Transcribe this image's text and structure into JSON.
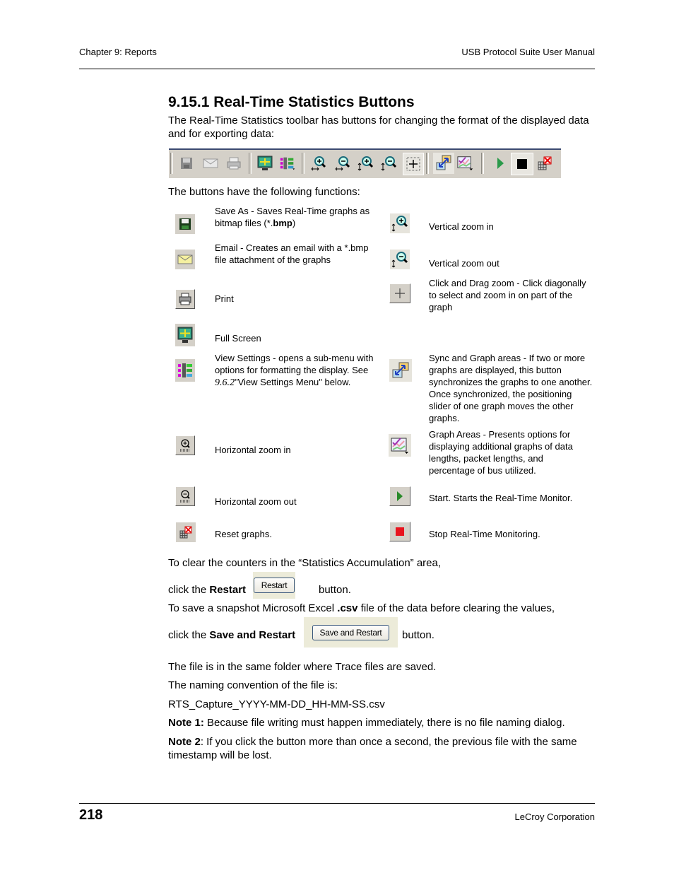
{
  "header": {
    "left": "Chapter 9: Reports",
    "right": "USB Protocol Suite User Manual"
  },
  "section": {
    "title": "9.15.1 Real-Time Statistics Buttons",
    "intro": "The Real-Time Statistics toolbar has buttons for changing the format of the displayed data and for exporting data:",
    "functions_intro": "The buttons have the following functions:"
  },
  "toolbar": {
    "buttons": [
      {
        "icon": "save-icon"
      },
      {
        "icon": "email-icon"
      },
      {
        "icon": "print-icon"
      },
      {
        "icon": "full-screen-icon"
      },
      {
        "icon": "view-settings-icon"
      },
      {
        "icon": "horizontal-zoom-in-icon"
      },
      {
        "icon": "horizontal-zoom-out-icon"
      },
      {
        "icon": "vertical-zoom-in-icon"
      },
      {
        "icon": "vertical-zoom-out-icon"
      },
      {
        "icon": "click-drag-zoom-icon"
      },
      {
        "icon": "sync-graphs-icon"
      },
      {
        "icon": "graph-areas-icon"
      },
      {
        "icon": "start-icon"
      },
      {
        "icon": "stop-icon"
      },
      {
        "icon": "reset-graphs-icon"
      }
    ]
  },
  "functions": {
    "left": [
      {
        "icon": "save-icon",
        "text_pre": "Save As - Saves Real-Time graphs as bitmap files (*.",
        "text_bold": "bmp",
        "text_post": ")"
      },
      {
        "icon": "email-icon",
        "text": "Email - Creates an email with a *.bmp file attachment of the graphs"
      },
      {
        "icon": "print-icon",
        "text": "Print"
      },
      {
        "icon": "full-screen-icon",
        "text": "Full Screen"
      },
      {
        "icon": "view-settings-icon",
        "text_pre": "View Settings - opens a sub-menu with options for formatting the display. See ",
        "text_ref": "9.6.2",
        "text_post": "\"View Settings Menu\" below."
      },
      {
        "icon": "horizontal-zoom-in-icon",
        "text": "Horizontal zoom in"
      },
      {
        "icon": "horizontal-zoom-out-icon",
        "text": "Horizontal zoom out"
      },
      {
        "icon": "reset-graphs-icon",
        "text": "Reset graphs."
      }
    ],
    "right": [
      {
        "icon": "vertical-zoom-in-icon",
        "text": "Vertical zoom in"
      },
      {
        "icon": "vertical-zoom-out-icon",
        "text": "Vertical zoom out"
      },
      {
        "icon": "click-drag-zoom-icon",
        "text": "Click and Drag zoom - Click diagonally to select and zoom in on part of the graph"
      },
      {
        "icon": "sync-graphs-icon",
        "text": "Sync and Graph areas - If two or more graphs are displayed, this button synchronizes the graphs to one another. Once synchronized, the positioning slider of one graph moves the other graphs."
      },
      {
        "icon": "graph-areas-icon",
        "text": "Graph Areas - Presents options for displaying additional graphs of data lengths, packet lengths, and percentage of bus utilized."
      },
      {
        "icon": "start-icon",
        "text": "Start. Starts the Real-Time Monitor."
      },
      {
        "icon": "stop-icon",
        "text": "Stop Real-Time Monitoring."
      }
    ]
  },
  "body": {
    "clear_counters": "To clear the counters in the “Statistics Accumulation” area,",
    "click_the": "click the ",
    "restart_bold": "Restart",
    "restart_button": "Restart",
    "button_suffix": "button.",
    "save_snapshot_pre": "To save a snapshot Microsoft Excel ",
    "save_snapshot_bold": ".csv",
    "save_snapshot_post": " file of the data before clearing the values,",
    "save_restart_bold": "Save and Restart",
    "save_restart_button": "Save and Restart",
    "file_location": "The file is in the same folder where Trace files are saved.",
    "naming_convention": "The naming convention of the file is:",
    "filename": "RTS_Capture_YYYY-MM-DD_HH-MM-SS.csv",
    "note1_label": "Note 1:",
    "note1_text": " Because file writing must happen immediately, there is no file naming dialog.",
    "note2_label": "Note 2",
    "note2_text": ": If you click the button more than once a second, the previous file with the same timestamp will be lost."
  },
  "footer": {
    "page_number": "218",
    "company": "LeCroy Corporation"
  }
}
